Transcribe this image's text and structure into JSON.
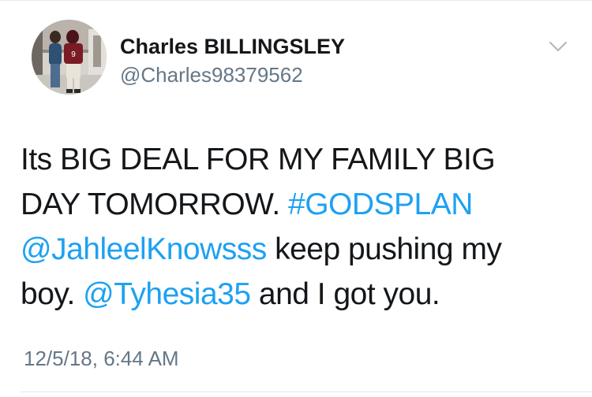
{
  "user": {
    "display_name": "Charles BILLINGSLEY",
    "handle": "@Charles98379562"
  },
  "tweet": {
    "line1": "Its BIG DEAL FOR MY FAMILY BIG",
    "line2_text": "DAY TOMORROW. ",
    "hashtag": "#GODSPLAN",
    "mention1": "@JahleelKnowsss",
    "line3_text": " keep pushing my",
    "line4_text": "boy. ",
    "mention2": "@Tyhesia35",
    "line4_tail": " and I got you."
  },
  "timestamp": "12/5/18, 6:44 AM",
  "colors": {
    "link": "#1da1f2",
    "secondary_text": "#657786",
    "primary_text": "#14171a"
  },
  "icons": {
    "menu": "chevron-down-icon"
  }
}
